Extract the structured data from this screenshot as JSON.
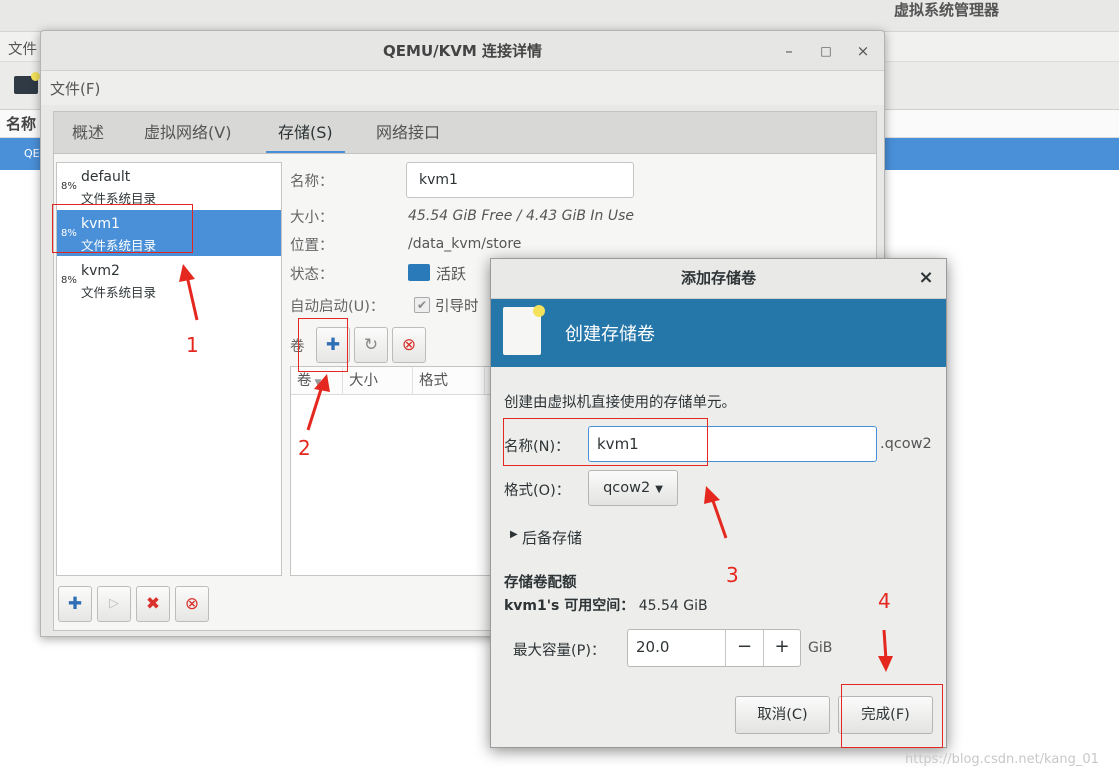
{
  "background": {
    "title": "虚拟系统管理器",
    "menu_file": "文件",
    "header_name": "名称",
    "row_prefix": "QE"
  },
  "conn_window": {
    "title": "QEMU/KVM 连接详情",
    "menu_file": "文件(F)",
    "tabs": [
      "概述",
      "虚拟网络(V)",
      "存储(S)",
      "网络接口"
    ],
    "pools": [
      {
        "pct": "8%",
        "name": "default",
        "type": "文件系统目录"
      },
      {
        "pct": "8%",
        "name": "kvm1",
        "type": "文件系统目录"
      },
      {
        "pct": "8%",
        "name": "kvm2",
        "type": "文件系统目录"
      }
    ],
    "details": {
      "name_label": "名称：",
      "name_value": "kvm1",
      "size_label": "大小：",
      "size_value_free": "45.54 GiB Free",
      "size_value_sep": " / ",
      "size_value_used": "4.43 GiB In Use",
      "location_label": "位置：",
      "location_value": "/data_kvm/store",
      "state_label": "状态：",
      "state_value": "活跃",
      "autostart_label": "自动启动(U)：",
      "autostart_value": "引导时"
    },
    "volumes_label": "卷",
    "vol_columns": [
      "卷",
      "大小",
      "格式"
    ]
  },
  "dialog": {
    "title": "添加存储卷",
    "close": "×",
    "banner_title": "创建存储卷",
    "description": "创建由虚拟机直接使用的存储单元。",
    "name_label": "名称(N)：",
    "name_value": "kvm1",
    "name_suffix": ".qcow2",
    "format_label": "格式(O)：",
    "format_value": "qcow2",
    "backing_label": "后备存储",
    "quota_title": "存储卷配额",
    "available_label": "kvm1's 可用空间：",
    "available_value": "45.54 GiB",
    "capacity_label": "最大容量(P)：",
    "capacity_value": "20.0",
    "capacity_unit": "GiB",
    "cancel_label": "取消(C)",
    "finish_label": "完成(F)"
  },
  "annotations": [
    "1",
    "2",
    "3",
    "4"
  ],
  "watermark": "https://blog.csdn.net/kang_01",
  "colors": {
    "accent": "#4a90d9",
    "banner": "#2576a9",
    "annotation": "#e5281f"
  }
}
